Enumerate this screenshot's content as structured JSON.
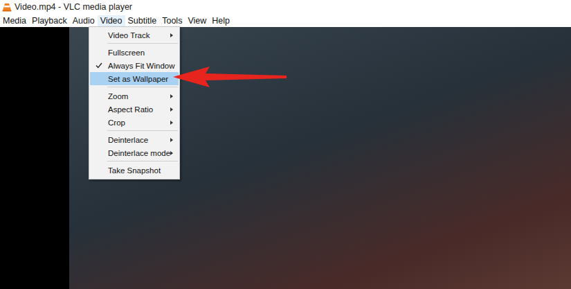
{
  "window": {
    "title": "Video.mp4 - VLC media player"
  },
  "menubar": [
    {
      "label": "Media",
      "selected": false
    },
    {
      "label": "Playback",
      "selected": false
    },
    {
      "label": "Audio",
      "selected": false
    },
    {
      "label": "Video",
      "selected": true
    },
    {
      "label": "Subtitle",
      "selected": false
    },
    {
      "label": "Tools",
      "selected": false
    },
    {
      "label": "View",
      "selected": false
    },
    {
      "label": "Help",
      "selected": false
    }
  ],
  "video_menu": {
    "groups": [
      {
        "items": [
          {
            "label": "Video Track",
            "checked": false,
            "submenu": true,
            "selected": false
          }
        ]
      },
      {
        "items": [
          {
            "label": "Fullscreen",
            "checked": false,
            "submenu": false,
            "selected": false
          },
          {
            "label": "Always Fit Window",
            "checked": true,
            "submenu": false,
            "selected": false
          },
          {
            "label": "Set as Wallpaper",
            "checked": false,
            "submenu": false,
            "selected": true
          }
        ]
      },
      {
        "items": [
          {
            "label": "Zoom",
            "checked": false,
            "submenu": true,
            "selected": false
          },
          {
            "label": "Aspect Ratio",
            "checked": false,
            "submenu": true,
            "selected": false
          },
          {
            "label": "Crop",
            "checked": false,
            "submenu": true,
            "selected": false
          }
        ]
      },
      {
        "items": [
          {
            "label": "Deinterlace",
            "checked": false,
            "submenu": true,
            "selected": false
          },
          {
            "label": "Deinterlace mode",
            "checked": false,
            "submenu": true,
            "selected": false
          }
        ]
      },
      {
        "items": [
          {
            "label": "Take Snapshot",
            "checked": false,
            "submenu": false,
            "selected": false
          }
        ]
      }
    ]
  }
}
